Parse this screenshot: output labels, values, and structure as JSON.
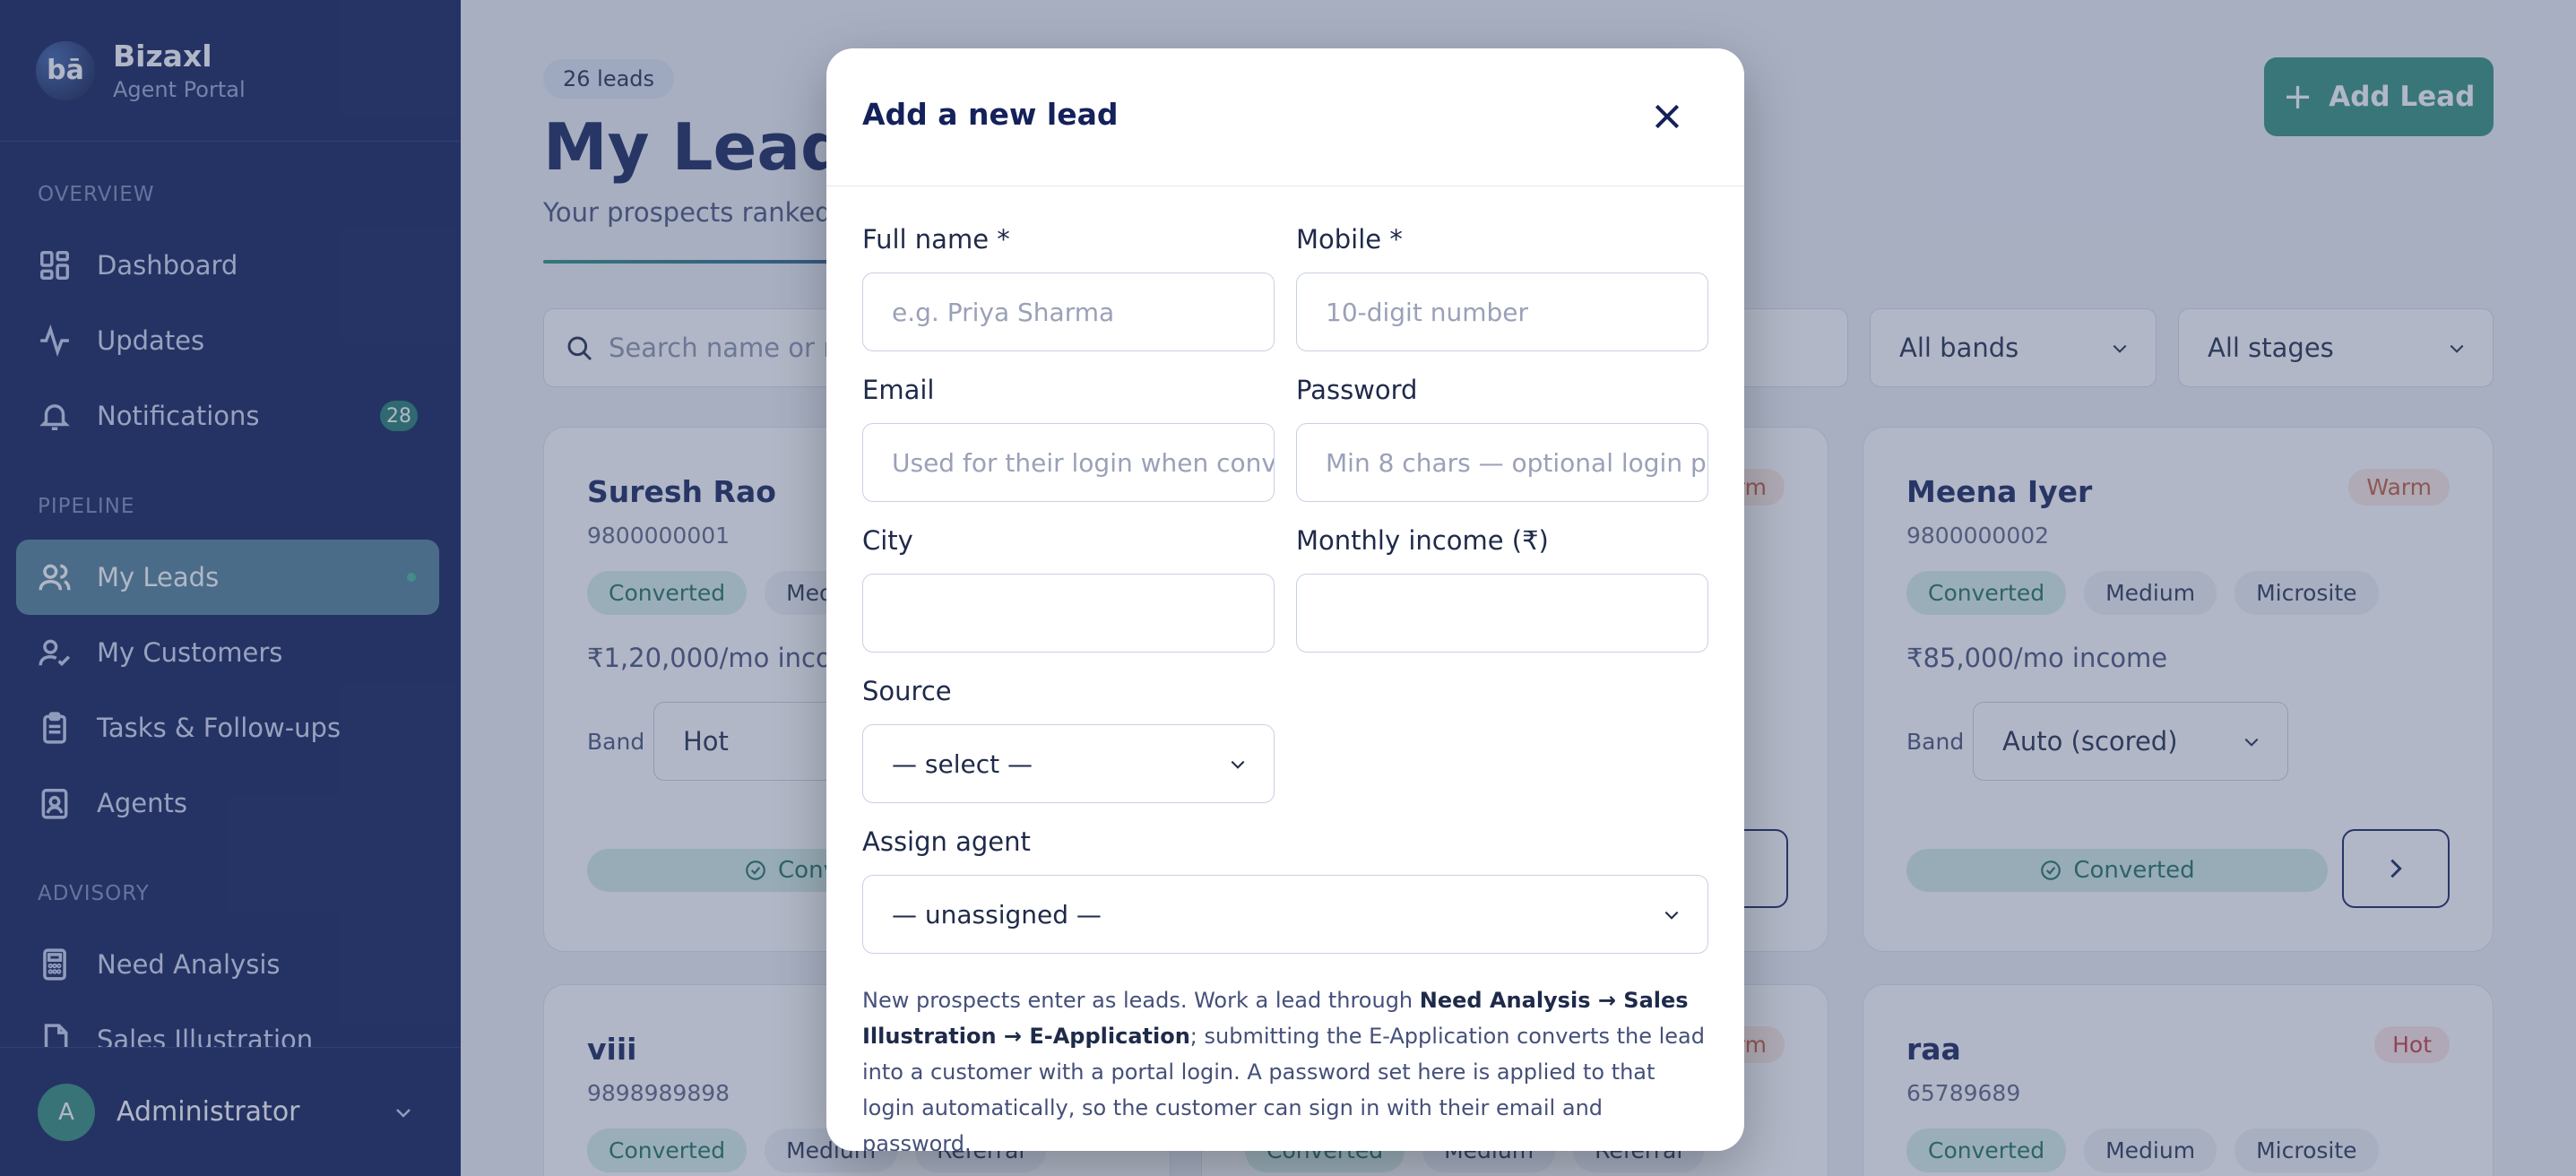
{
  "brand": {
    "logo": "bā",
    "name": "Bizaxl",
    "sub": "Agent Portal"
  },
  "sidebar": {
    "sections": [
      "OVERVIEW",
      "PIPELINE",
      "ADVISORY"
    ],
    "overview": [
      {
        "label": "Dashboard",
        "icon": "dashboard-icon"
      },
      {
        "label": "Updates",
        "icon": "activity-icon"
      },
      {
        "label": "Notifications",
        "icon": "bell-icon",
        "badge": "28"
      }
    ],
    "pipeline": [
      {
        "label": "My Leads",
        "icon": "users-icon"
      },
      {
        "label": "My Customers",
        "icon": "user-check-icon"
      },
      {
        "label": "Tasks & Follow-ups",
        "icon": "clipboard-icon"
      },
      {
        "label": "Agents",
        "icon": "id-badge-icon"
      }
    ],
    "advisory": [
      {
        "label": "Need Analysis",
        "icon": "calculator-icon"
      },
      {
        "label": "Sales Illustration",
        "icon": "file-icon"
      }
    ],
    "user": {
      "initial": "A",
      "name": "Administrator"
    }
  },
  "header": {
    "count": "26 leads",
    "title": "My Leads",
    "subtitle": "Your prospects ranked b",
    "add_button": "Add Lead"
  },
  "filters": {
    "search_placeholder": "Search name or m",
    "bands": "All bands",
    "stages": "All stages"
  },
  "cards": [
    {
      "name": "Suresh Rao",
      "phone": "9800000001",
      "tags": [
        "Converted",
        "Medi"
      ],
      "income": "₹1,20,000/mo incom",
      "band": "Hot",
      "button": "Conve"
    },
    {
      "name": "Meena Iyer",
      "phone": "9800000002",
      "tags": [
        "Converted",
        "Medium",
        "Microsite"
      ],
      "income": "₹85,000/mo income",
      "band": "Auto (scored)",
      "button": "Converted",
      "temp": "Warm"
    },
    {
      "name": "viii",
      "phone": "9898989898",
      "tags": [
        "Converted",
        "Medium",
        "Referral"
      ]
    },
    {
      "name": "raa",
      "phone": "65789689",
      "tags": [
        "Converted",
        "Medium",
        "Microsite"
      ],
      "temp": "Hot"
    }
  ],
  "middle_cards": {
    "temp": "rm",
    "tags": [
      "Converted",
      "Medium",
      "Referral"
    ]
  },
  "modal": {
    "title": "Add a new lead",
    "full_name_label": "Full name *",
    "full_name_placeholder": "e.g. Priya Sharma",
    "mobile_label": "Mobile *",
    "mobile_placeholder": "10-digit number",
    "email_label": "Email",
    "email_placeholder": "Used for their login when conv",
    "password_label": "Password",
    "password_placeholder": "Min 8 chars — optional login pa",
    "city_label": "City",
    "income_label": "Monthly income (₹)",
    "source_label": "Source",
    "source_value": "— select —",
    "agent_label": "Assign agent",
    "agent_value": "— unassigned —",
    "help_1": "New prospects enter as leads. Work a lead through ",
    "help_bold": "Need Analysis → Sales Illustration → E-Application",
    "help_2": "; submitting the E-Application converts the lead into a customer with a portal login. A password set here is applied to that login automatically, so the customer can sign in with their email and password."
  }
}
